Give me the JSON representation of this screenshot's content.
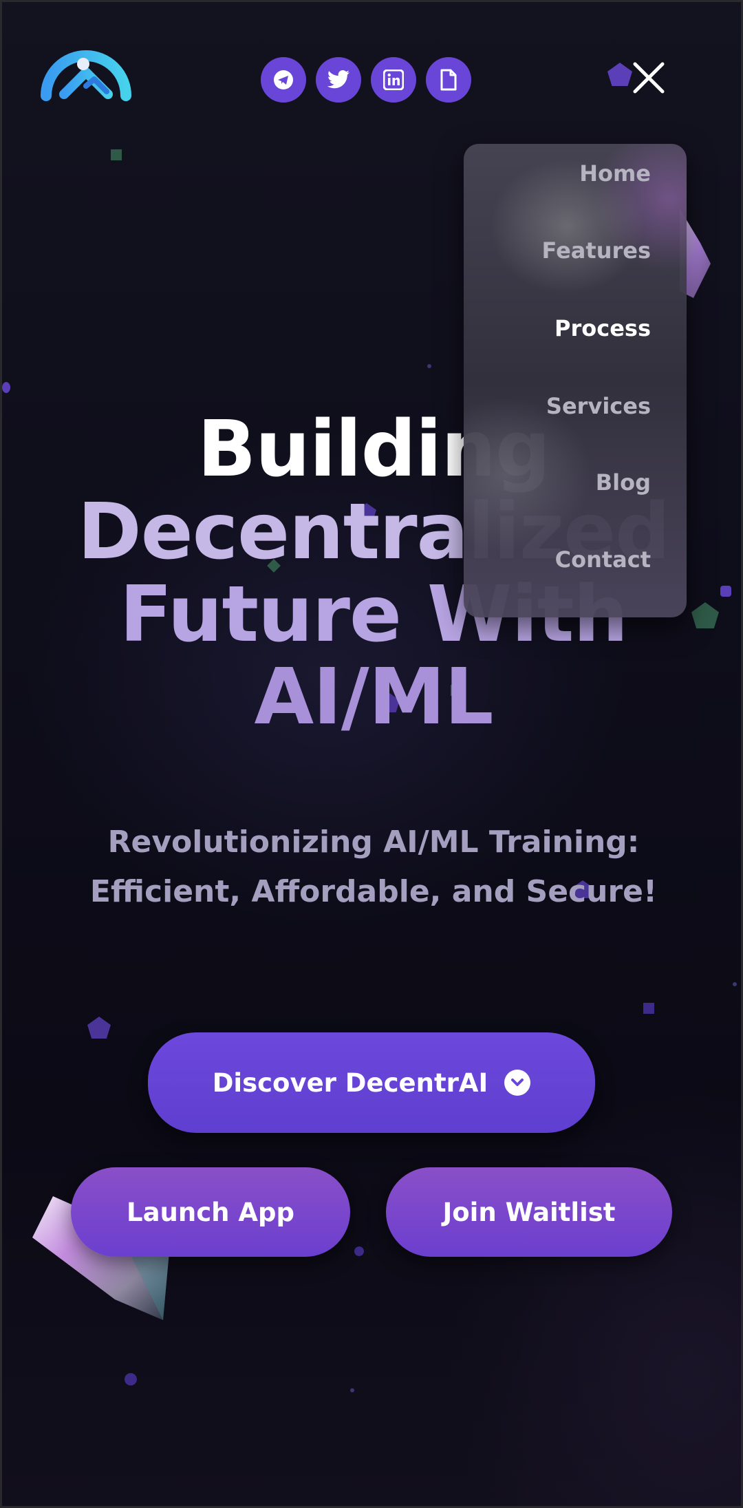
{
  "colors": {
    "accent": "#6a46d8",
    "background": "#0c0b16",
    "menu_active": "#ffffff",
    "menu_inactive": "#b7b4c2"
  },
  "header": {
    "logo_icon": "brand-logo-icon",
    "social_links": [
      {
        "name": "telegram",
        "icon": "telegram-icon"
      },
      {
        "name": "twitter",
        "icon": "twitter-icon"
      },
      {
        "name": "linkedin",
        "icon": "linkedin-icon"
      },
      {
        "name": "document",
        "icon": "document-icon"
      }
    ],
    "close_icon": "close-icon"
  },
  "nav_menu": {
    "items": [
      {
        "label": "Home"
      },
      {
        "label": "Features"
      },
      {
        "label": "Process",
        "active": true
      },
      {
        "label": "Services"
      },
      {
        "label": "Blog"
      },
      {
        "label": "Contact"
      }
    ]
  },
  "hero": {
    "title_line1": "Building",
    "title_line2": "Decentralized",
    "title_line3": "Future With",
    "title_line4": "AI/ML",
    "subtitle_line1": "Revolutionizing AI/ML Training:",
    "subtitle_line2": "Efficient, Affordable, and Secure!"
  },
  "buttons": {
    "discover": "Discover DecentrAI",
    "launch": "Launch App",
    "waitlist": "Join Waitlist"
  }
}
